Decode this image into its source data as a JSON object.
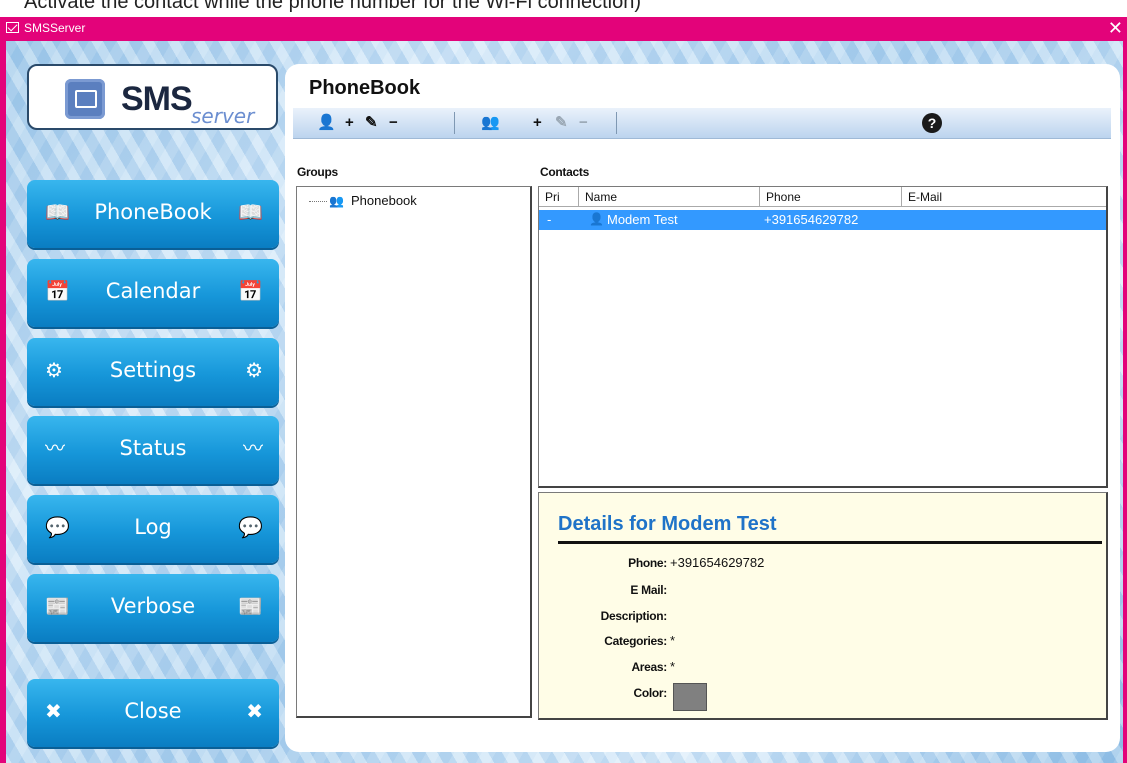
{
  "top_strip_text": "Activate the contact while the phone number for the Wi-Fi connection)",
  "window": {
    "title": "SMSServer",
    "close_glyph": "✕"
  },
  "logo": {
    "brand_main": "SMS",
    "brand_sub": "server"
  },
  "nav": [
    {
      "label": "PhoneBook",
      "icon": "book-icon",
      "glyph": "📖"
    },
    {
      "label": "Calendar",
      "icon": "calendar-icon",
      "glyph": "📅"
    },
    {
      "label": "Settings",
      "icon": "gear-icon",
      "glyph": "⚙"
    },
    {
      "label": "Status",
      "icon": "pulse-icon",
      "glyph": "〰"
    },
    {
      "label": "Log",
      "icon": "chat-icon",
      "glyph": "💬"
    },
    {
      "label": "Verbose",
      "icon": "verbose-icon",
      "glyph": "📰"
    },
    {
      "label": "Close",
      "icon": "close-icon",
      "glyph": "✖"
    }
  ],
  "main": {
    "title": "PhoneBook",
    "groups_label": "Groups",
    "contacts_label": "Contacts",
    "toolbar": {
      "contact_glyph": "👤",
      "add": "+",
      "edit": "✎",
      "remove": "−",
      "group_glyph": "👥",
      "help": "?"
    }
  },
  "groups_tree": [
    {
      "label": "Phonebook",
      "icon": "group-icon",
      "glyph": "👥"
    }
  ],
  "contacts_table": {
    "columns": [
      "Pri",
      "Name",
      "Phone",
      "E-Mail"
    ],
    "rows": [
      {
        "pri": "-",
        "icon": "person-icon",
        "glyph": "👤",
        "name": "Modem Test",
        "phone": "+391654629782",
        "email": ""
      }
    ]
  },
  "details": {
    "title": "Details for  Modem Test",
    "fields": [
      {
        "key": "Phone:",
        "value": "+391654629782"
      },
      {
        "key": "E Mail:",
        "value": ""
      },
      {
        "key": "Description:",
        "value": ""
      },
      {
        "key": "Categories:",
        "value": "*"
      },
      {
        "key": "Areas:",
        "value": "*"
      },
      {
        "key": "Color:",
        "value": ""
      }
    ],
    "color_value": "#808080"
  }
}
